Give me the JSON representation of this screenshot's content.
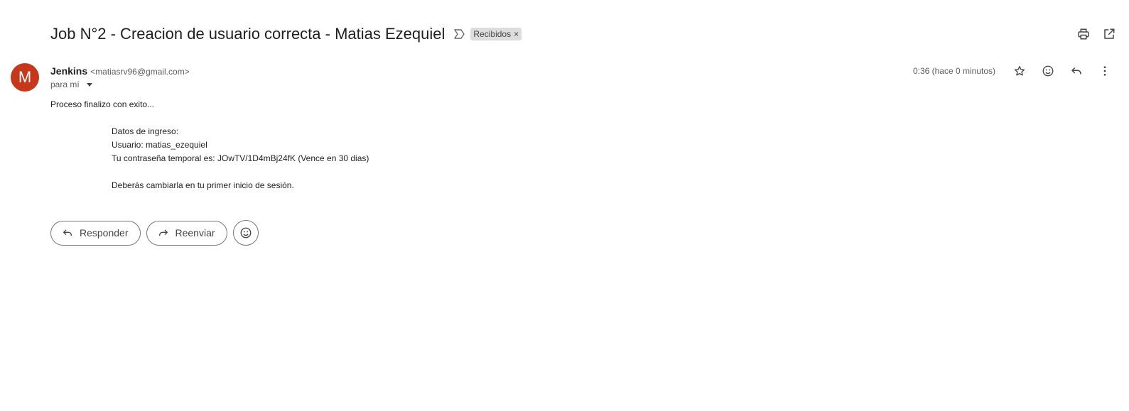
{
  "subject": {
    "title": "Job N°2 - Creacion de usuario correcta - Matias Ezequiel",
    "label": "Recibidos",
    "label_remove": "×"
  },
  "sender": {
    "avatar_letter": "M",
    "avatar_color": "#c5381b",
    "name": "Jenkins",
    "email": "<matiasrv96@gmail.com>",
    "to": "para mí",
    "timestamp": "0:36 (hace 0 minutos)"
  },
  "body": {
    "intro": "Proceso finalizo con exito...",
    "lines": [
      "Datos de ingreso:",
      "Usuario: matias_ezequiel",
      "Tu contraseña temporal es: JOwTV/1D4mBj24fK (Vence en 30 dias)",
      "Deberás cambiarla en tu primer inicio de sesión."
    ]
  },
  "actions": {
    "reply_label": "Responder",
    "forward_label": "Reenviar"
  },
  "icons": {
    "importance": "importance-marker-icon",
    "print": "print-icon",
    "open_new_window": "open-in-new-window-icon",
    "star": "star-icon",
    "emoji": "emoji-icon",
    "reply": "reply-icon",
    "more": "more-vert-icon",
    "forward": "forward-icon"
  }
}
